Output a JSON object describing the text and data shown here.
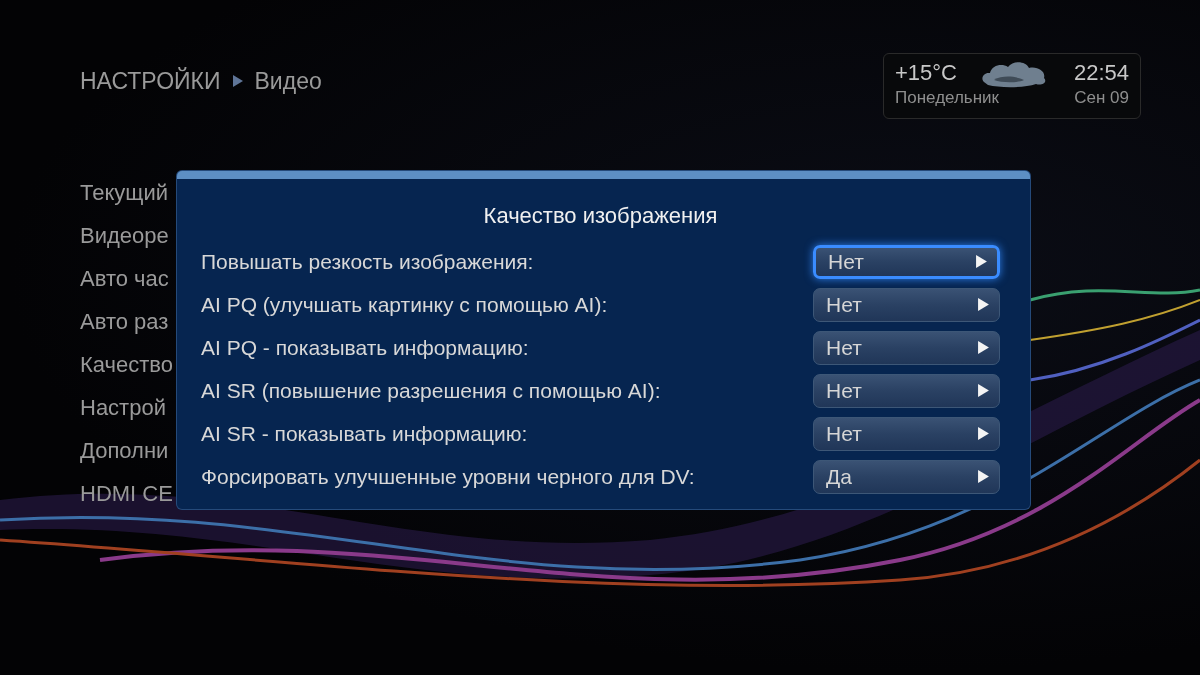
{
  "breadcrumb": {
    "section": "НАСТРОЙКИ",
    "page": "Видео"
  },
  "weather": {
    "temperature": "+15°C",
    "time": "22:54",
    "day": "Понедельник",
    "date": "Сен 09"
  },
  "menu": {
    "items": [
      {
        "label": "Текущий"
      },
      {
        "label": "Видеоре"
      },
      {
        "label": "Авто час"
      },
      {
        "label": "Авто раз"
      },
      {
        "label": "Качество"
      },
      {
        "label": "Настрой"
      },
      {
        "label": "Дополни"
      },
      {
        "label": "HDMI CE"
      }
    ]
  },
  "dialog": {
    "title": "Качество изображения",
    "options": [
      {
        "label": "Повышать резкость изображения:",
        "value": "Нет",
        "selected": true
      },
      {
        "label": "AI PQ (улучшать картинку с помощью AI):",
        "value": "Нет",
        "selected": false
      },
      {
        "label": "AI PQ - показывать информацию:",
        "value": "Нет",
        "selected": false
      },
      {
        "label": "AI SR (повышение разрешения с помощью AI):",
        "value": "Нет",
        "selected": false
      },
      {
        "label": "AI SR - показывать информацию:",
        "value": "Нет",
        "selected": false
      },
      {
        "label": "Форсировать улучшенные уровни черного для DV:",
        "value": "Да",
        "selected": false
      }
    ]
  }
}
